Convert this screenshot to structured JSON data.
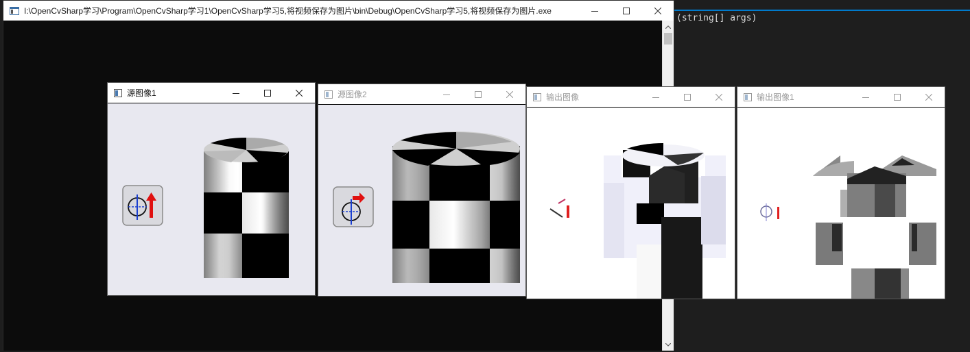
{
  "vs": {
    "code_fragment": "(string[] args)"
  },
  "console": {
    "title": "I:\\OpenCvSharp学习\\Program\\OpenCvSharp学习1\\OpenCvSharp学习5,将视频保存为图片\\bin\\Debug\\OpenCvSharp学习5,将视频保存为图片.exe",
    "controls": [
      "minimize-icon",
      "maximize-icon",
      "close-icon"
    ]
  },
  "windows": [
    {
      "id": "source1",
      "title": "源图像1",
      "state": "active"
    },
    {
      "id": "source2",
      "title": "源图像2",
      "state": "inactive"
    },
    {
      "id": "output",
      "title": "输出图像",
      "state": "inactive"
    },
    {
      "id": "output1",
      "title": "输出图像1",
      "state": "inactive"
    }
  ],
  "colors": {
    "console_bg": "#0c0c0c",
    "vs_bg": "#1e1e1e",
    "accent": "#007acc",
    "source_image_bg": "#e8e8f0",
    "output_image_bg": "#ffffff"
  }
}
